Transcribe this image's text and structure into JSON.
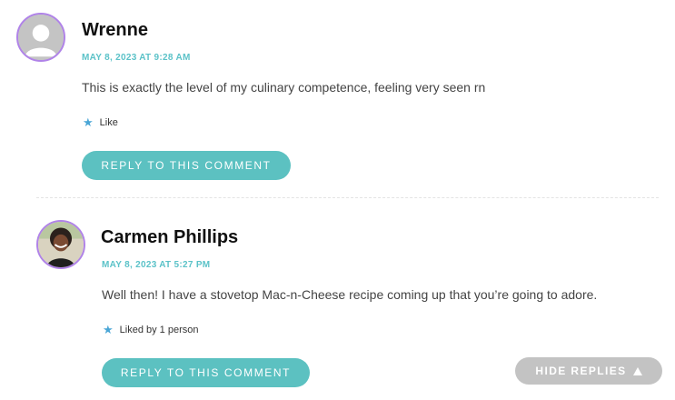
{
  "comments": [
    {
      "author": "Wrenne",
      "date": "MAY 8, 2023 AT 9:28 AM",
      "text": "This is exactly the level of my culinary competence, feeling very seen rn",
      "like_label": "Like",
      "reply_label": "REPLY TO THIS COMMENT",
      "avatar_icon": "default-user-avatar-icon"
    },
    {
      "author": "Carmen Phillips",
      "date": "MAY 8, 2023 AT 5:27 PM",
      "text": "Well then! I have a stovetop Mac-n-Cheese recipe coming up that you’re going to adore.",
      "like_label": "Liked by 1 person",
      "reply_label": "REPLY TO THIS COMMENT",
      "avatar_icon": "profile-photo-avatar"
    }
  ],
  "hide_replies_label": "HIDE REPLIES",
  "colors": {
    "accent": "#5cc1c1",
    "date": "#5bc2c8",
    "avatar_border": "#b083e8",
    "hide_button": "#c3c3c3",
    "star": "#4aa6d6"
  }
}
